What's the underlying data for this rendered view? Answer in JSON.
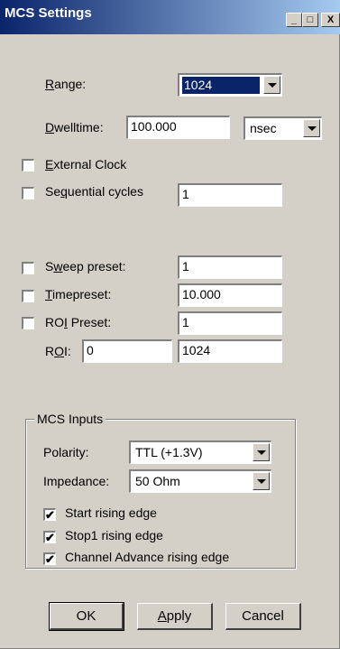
{
  "window": {
    "title": "MCS Settings",
    "buttons": {
      "minimize": "_",
      "maximize": "□",
      "close": "X"
    }
  },
  "range": {
    "label_prefix": "",
    "label_u": "R",
    "label_rest": "ange:",
    "value": "1024"
  },
  "dwelltime": {
    "label_u": "D",
    "label_rest": "welltime:",
    "value": "100.000",
    "unit": "nsec"
  },
  "external_clock": {
    "label_u": "E",
    "label_rest": "xternal Clock",
    "checked": false
  },
  "sequential_cycles": {
    "label_pre": "Se",
    "label_u": "q",
    "label_rest": "uential cycles",
    "checked": false,
    "value": "1"
  },
  "sweep_preset": {
    "label_pre": "S",
    "label_u": "w",
    "label_rest": "eep preset:",
    "checked": false,
    "value": "1"
  },
  "timepreset": {
    "label_u": "T",
    "label_rest": "imepreset:",
    "checked": false,
    "value": "10.000"
  },
  "roi_preset": {
    "label_pre": "RO",
    "label_u": "I",
    "label_rest": " Preset:",
    "checked": false,
    "value": "1"
  },
  "roi": {
    "label_pre": "R",
    "label_u": "O",
    "label_rest": "I:",
    "from": "0",
    "to": "1024"
  },
  "mcs_inputs": {
    "legend": "MCS Inputs",
    "polarity_label": "Polarity:",
    "polarity_value": "TTL (+1.3V)",
    "impedance_label": "Impedance:",
    "impedance_value": "50 Ohm",
    "start_rising": {
      "label": "Start rising edge",
      "checked": true
    },
    "stop1_rising": {
      "label": "Stop1 rising edge",
      "checked": true
    },
    "channel_adv": {
      "label": "Channel Advance rising edge",
      "checked": true
    }
  },
  "buttons": {
    "ok": "OK",
    "apply_u": "A",
    "apply_rest": "pply",
    "cancel": "Cancel"
  },
  "check_glyph": "✔"
}
